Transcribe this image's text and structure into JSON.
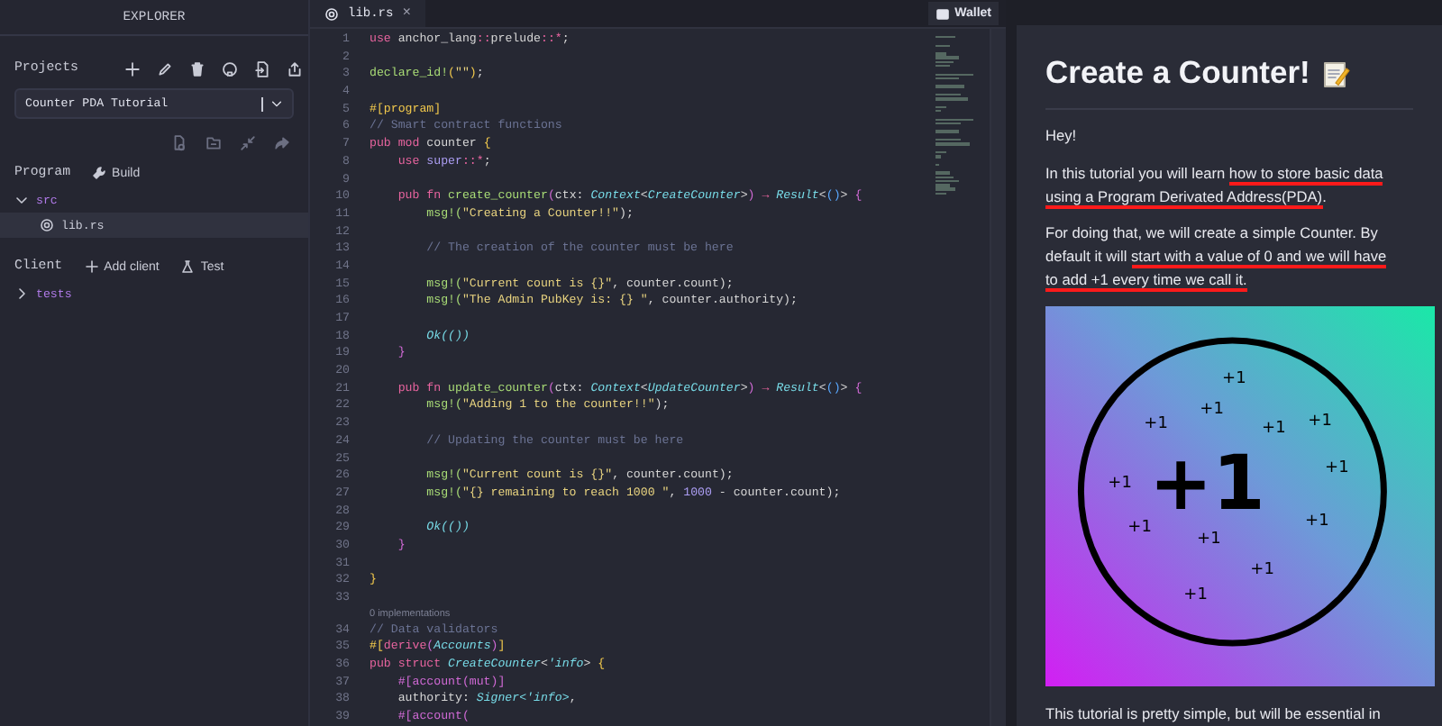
{
  "explorer": {
    "title": "EXPLORER",
    "projects_label": "Projects",
    "project_select": {
      "value": "Counter PDA Tutorial"
    },
    "program_label": "Program",
    "build_button": "Build",
    "program_tree": [
      {
        "label": "src",
        "expanded": true,
        "selected": false,
        "children": [
          {
            "label": "lib.rs",
            "selected": true
          }
        ]
      }
    ],
    "client_label": "Client",
    "add_client_button": "Add client",
    "test_button": "Test",
    "client_tree": [
      {
        "label": "tests",
        "expanded": false,
        "selected": false
      }
    ]
  },
  "editor": {
    "tabs": [
      {
        "label": "lib.rs",
        "selected": true,
        "close": "×"
      }
    ],
    "wallet_button": "Wallet",
    "lines": [
      {
        "number": "1",
        "tokens": [
          {
            "text": "use",
            "kind": "kw"
          },
          {
            "text": " anchor_lang",
            "kind": "p"
          },
          {
            "text": "::",
            "kind": "op"
          },
          {
            "text": "prelude",
            "kind": "p"
          },
          {
            "text": "::*",
            "kind": "op"
          },
          {
            "text": ";",
            "kind": "p"
          }
        ]
      },
      {
        "number": "2"
      },
      {
        "number": "3",
        "tokens": [
          {
            "text": "declare_id!",
            "kind": "fn"
          },
          {
            "text": "(",
            "kind": "b1"
          },
          {
            "text": "\"\"",
            "kind": "str"
          },
          {
            "text": ")",
            "kind": "b1"
          },
          {
            "text": ";",
            "kind": "p"
          }
        ]
      },
      {
        "number": "4"
      },
      {
        "number": "5",
        "tokens": [
          {
            "text": "#[program]",
            "kind": "attr"
          }
        ]
      },
      {
        "number": "6",
        "tokens": [
          {
            "text": "// Smart contract functions",
            "kind": "cm"
          }
        ]
      },
      {
        "number": "7",
        "tokens": [
          {
            "text": "pub mod",
            "kind": "kw"
          },
          {
            "text": " counter ",
            "kind": "p"
          },
          {
            "text": "{",
            "kind": "b1"
          }
        ]
      },
      {
        "number": "8",
        "tokens": [
          {
            "text": "    use ",
            "kind": "kw"
          },
          {
            "text": "super",
            "kind": "num"
          },
          {
            "text": "::*",
            "kind": "op"
          },
          {
            "text": ";",
            "kind": "p"
          }
        ]
      },
      {
        "number": "9"
      },
      {
        "number": "10",
        "tokens": [
          {
            "text": "    pub fn",
            "kind": "kw"
          },
          {
            "text": " create_counter",
            "kind": "fn"
          },
          {
            "text": "(",
            "kind": "b2"
          },
          {
            "text": "ctx: ",
            "kind": "p"
          },
          {
            "text": "Context",
            "kind": "ty"
          },
          {
            "text": "<",
            "kind": "p"
          },
          {
            "text": "CreateCounter",
            "kind": "ty"
          },
          {
            "text": ">",
            "kind": "p"
          },
          {
            "text": ")",
            "kind": "b2"
          },
          {
            "text": " → ",
            "kind": "op"
          },
          {
            "text": "Result",
            "kind": "ty"
          },
          {
            "text": "<",
            "kind": "p"
          },
          {
            "text": "()",
            "kind": "b3"
          },
          {
            "text": "> ",
            "kind": "p"
          },
          {
            "text": "{",
            "kind": "b2"
          }
        ]
      },
      {
        "number": "11",
        "tokens": [
          {
            "text": "        msg!(",
            "kind": "fn"
          },
          {
            "text": "\"Creating a Counter!!\"",
            "kind": "str"
          },
          {
            "text": ");",
            "kind": "p"
          }
        ]
      },
      {
        "number": "12"
      },
      {
        "number": "13",
        "tokens": [
          {
            "text": "        // The creation of the counter must be here",
            "kind": "cm"
          }
        ]
      },
      {
        "number": "14"
      },
      {
        "number": "15",
        "tokens": [
          {
            "text": "        msg!(",
            "kind": "fn"
          },
          {
            "text": "\"Current count is {}\"",
            "kind": "str"
          },
          {
            "text": ", counter.count);",
            "kind": "p"
          }
        ]
      },
      {
        "number": "16",
        "tokens": [
          {
            "text": "        msg!(",
            "kind": "fn"
          },
          {
            "text": "\"The Admin PubKey is: {} \"",
            "kind": "str"
          },
          {
            "text": ", counter.authority);",
            "kind": "p"
          }
        ]
      },
      {
        "number": "17"
      },
      {
        "number": "18",
        "tokens": [
          {
            "text": "        Ok(())",
            "kind": "ty"
          }
        ]
      },
      {
        "number": "19",
        "tokens": [
          {
            "text": "    }",
            "kind": "bracket"
          }
        ]
      },
      {
        "number": "20"
      },
      {
        "number": "21",
        "tokens": [
          {
            "text": "    pub fn",
            "kind": "kw"
          },
          {
            "text": " update_counter",
            "kind": "fn"
          },
          {
            "text": "(",
            "kind": "b2"
          },
          {
            "text": "ctx: ",
            "kind": "p"
          },
          {
            "text": "Context",
            "kind": "ty"
          },
          {
            "text": "<",
            "kind": "p"
          },
          {
            "text": "UpdateCounter",
            "kind": "ty"
          },
          {
            "text": ">",
            "kind": "p"
          },
          {
            "text": ")",
            "kind": "b2"
          },
          {
            "text": " → ",
            "kind": "op"
          },
          {
            "text": "Result",
            "kind": "ty"
          },
          {
            "text": "<",
            "kind": "p"
          },
          {
            "text": "()",
            "kind": "b3"
          },
          {
            "text": "> ",
            "kind": "p"
          },
          {
            "text": "{",
            "kind": "b2"
          }
        ]
      },
      {
        "number": "22",
        "tokens": [
          {
            "text": "        msg!(",
            "kind": "fn"
          },
          {
            "text": "\"Adding 1 to the counter!!\"",
            "kind": "str"
          },
          {
            "text": ");",
            "kind": "p"
          }
        ]
      },
      {
        "number": "23"
      },
      {
        "number": "24",
        "tokens": [
          {
            "text": "        // Updating the counter must be here",
            "kind": "cm"
          }
        ]
      },
      {
        "number": "25"
      },
      {
        "number": "26",
        "tokens": [
          {
            "text": "        msg!(",
            "kind": "fn"
          },
          {
            "text": "\"Current count is {}\"",
            "kind": "str"
          },
          {
            "text": ", counter.count);",
            "kind": "p"
          }
        ]
      },
      {
        "number": "27",
        "tokens": [
          {
            "text": "        msg!(",
            "kind": "fn"
          },
          {
            "text": "\"{} remaining to reach 1000 \"",
            "kind": "str"
          },
          {
            "text": ", ",
            "kind": "p"
          },
          {
            "text": "1000",
            "kind": "num"
          },
          {
            "text": " - counter.count);",
            "kind": "p"
          }
        ]
      },
      {
        "number": "28"
      },
      {
        "number": "29",
        "tokens": [
          {
            "text": "        Ok(())",
            "kind": "ty"
          }
        ]
      },
      {
        "number": "30",
        "tokens": [
          {
            "text": "    }",
            "kind": "bracket"
          }
        ]
      },
      {
        "number": "31"
      },
      {
        "number": "32",
        "tokens": [
          {
            "text": "}",
            "kind": "attr"
          }
        ]
      },
      {
        "number": "33"
      },
      {
        "number": "34",
        "codelens": "0 implementations",
        "tokens": [
          {
            "text": "// Data validators",
            "kind": "cm"
          }
        ]
      },
      {
        "number": "35",
        "tokens": [
          {
            "text": "#[",
            "kind": "attr"
          },
          {
            "text": "derive",
            "kind": "kw"
          },
          {
            "text": "(",
            "kind": "bracket"
          },
          {
            "text": "Accounts",
            "kind": "ty"
          },
          {
            "text": ")",
            "kind": "bracket"
          },
          {
            "text": "]",
            "kind": "attr"
          }
        ]
      },
      {
        "number": "36",
        "tokens": [
          {
            "text": "pub struct ",
            "kind": "kw"
          },
          {
            "text": "CreateCounter",
            "kind": "ty"
          },
          {
            "text": "<",
            "kind": "p"
          },
          {
            "text": "'info",
            "kind": "ty"
          },
          {
            "text": "> ",
            "kind": "p"
          },
          {
            "text": "{",
            "kind": "attr"
          }
        ]
      },
      {
        "number": "37",
        "tokens": [
          {
            "text": "    #[account(mut)]",
            "kind": "bracket"
          }
        ]
      },
      {
        "number": "38",
        "tokens": [
          {
            "text": "    authority: ",
            "kind": "p"
          },
          {
            "text": "Signer<'info>",
            "kind": "ty"
          },
          {
            "text": ",",
            "kind": "p"
          }
        ]
      },
      {
        "number": "39",
        "tokens": [
          {
            "text": "    #[account(",
            "kind": "bracket"
          }
        ]
      }
    ]
  },
  "tutorial": {
    "title": "Create a Counter!",
    "paragraphs": [
      {
        "segments": [
          {
            "text": "Hey!",
            "underlined": false
          }
        ]
      },
      {
        "segments": [
          {
            "text": "In this tutorial you will learn ",
            "underlined": false
          },
          {
            "text": "how to store basic data using a Program Derivated Address(PDA)",
            "underlined": true
          },
          {
            "text": ".",
            "underlined": false
          }
        ]
      },
      {
        "segments": [
          {
            "text": "For doing that, we will create a simple Counter. By default it will ",
            "underlined": false
          },
          {
            "text": "start with a value of 0 and we will have to add +1 every time we call it.",
            "underlined": true
          }
        ]
      }
    ],
    "illustration": {
      "big_label": "+1",
      "small_labels": [
        "+1",
        "+1",
        "+1",
        "+1",
        "+1",
        "+1",
        "+1",
        "+1",
        "+1",
        "+1",
        "+1",
        "+1"
      ]
    },
    "footer_text": "This tutorial is pretty simple, but will be essential in"
  }
}
